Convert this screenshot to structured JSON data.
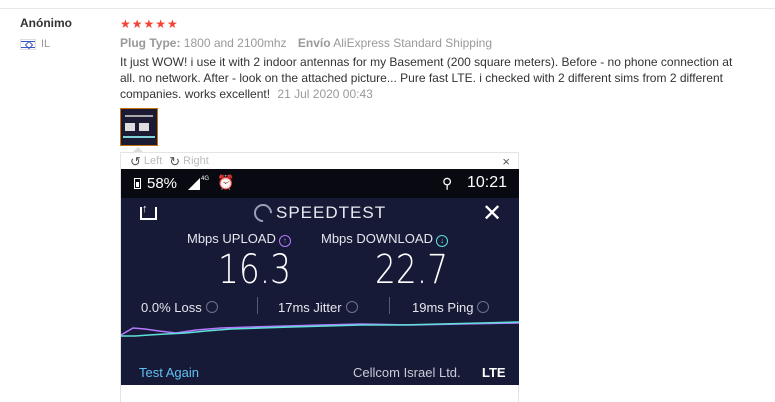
{
  "reviewer": {
    "name": "Anónimo",
    "country": "IL"
  },
  "review": {
    "stars": "★★★★★",
    "attributes": [
      {
        "key": "Plug Type:",
        "value": "1800 and 2100mhz"
      },
      {
        "key": "Envío",
        "value": "AliExpress Standard Shipping"
      }
    ],
    "text": "It just WOW! i use it with 2 indoor antennas for my Basement (200 square meters). Before - no phone connection at all. no network. After - look on the attached picture... Pure fast LTE. i checked with 2 different sims from 2 different companies. works excellent!",
    "date": "21 Jul 2020 00:43"
  },
  "viewer": {
    "left_label": "Left",
    "right_label": "Right",
    "close_glyph": "×",
    "rotate_left_glyph": "↺",
    "rotate_right_glyph": "↻"
  },
  "speedtest": {
    "battery": "58%",
    "network_type": "4G",
    "alarm_glyph": "⏰",
    "location_glyph": "⚲",
    "time": "10:21",
    "title": "SPEEDTEST",
    "close_glyph": "✕",
    "upload_label": "Mbps UPLOAD",
    "upload_glyph": "↑",
    "download_label": "Mbps DOWNLOAD",
    "download_glyph": "↓",
    "upload_value": "16.3",
    "download_value": "22.7",
    "loss": "0.0% Loss",
    "jitter": "17ms  Jitter",
    "ping": "19ms  Ping",
    "test_again": "Test Again",
    "carrier": "Cellcom Israel Ltd.",
    "tech": "LTE",
    "colors": {
      "background": "#161a37",
      "upload": "#b479ff",
      "download": "#5ee0d9",
      "link": "#5fc0f2"
    }
  }
}
